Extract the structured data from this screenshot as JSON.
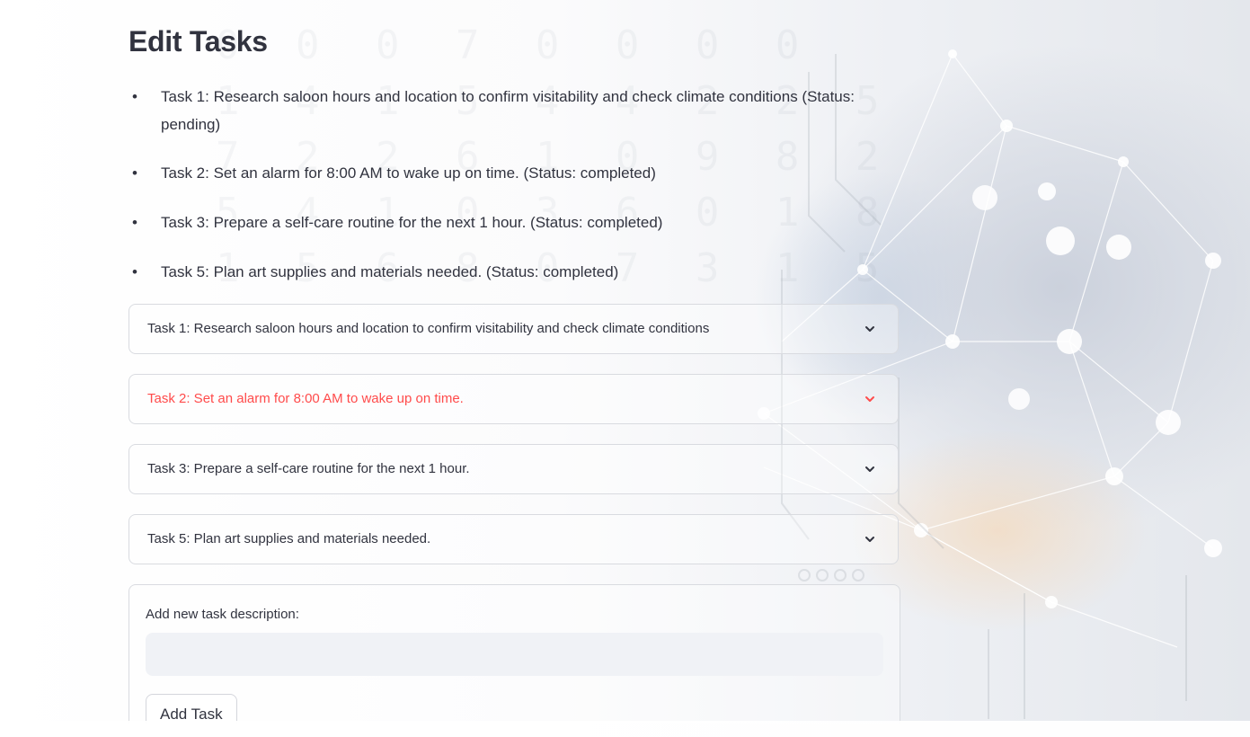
{
  "page": {
    "title": "Edit Tasks"
  },
  "tasks_summary": [
    {
      "text": "Task 1: Research saloon hours and location to confirm visitability and check climate conditions (Status: pending)"
    },
    {
      "text": "Task 2: Set an alarm for 8:00 AM to wake up on time. (Status: completed)"
    },
    {
      "text": "Task 3: Prepare a self-care routine for the next 1 hour. (Status: completed)"
    },
    {
      "text": "Task 5: Plan art supplies and materials needed. (Status: completed)"
    }
  ],
  "expanders": [
    {
      "label": "Task 1: Research saloon hours and location to confirm visitability and check climate conditions",
      "active": false
    },
    {
      "label": "Task 2: Set an alarm for 8:00 AM to wake up on time.",
      "active": true
    },
    {
      "label": "Task 3: Prepare a self-care routine for the next 1 hour.",
      "active": false
    },
    {
      "label": "Task 5: Plan art supplies and materials needed.",
      "active": false
    }
  ],
  "add_form": {
    "input_label": "Add new task description:",
    "input_value": "",
    "button_label": "Add Task"
  },
  "colors": {
    "text": "#31333f",
    "accent": "#ff4b4b",
    "input_bg": "#f0f2f6",
    "border": "#d9dbe0"
  },
  "icons": {
    "expander_toggle": "chevron-down-icon",
    "list_bullet": "bullet"
  }
}
